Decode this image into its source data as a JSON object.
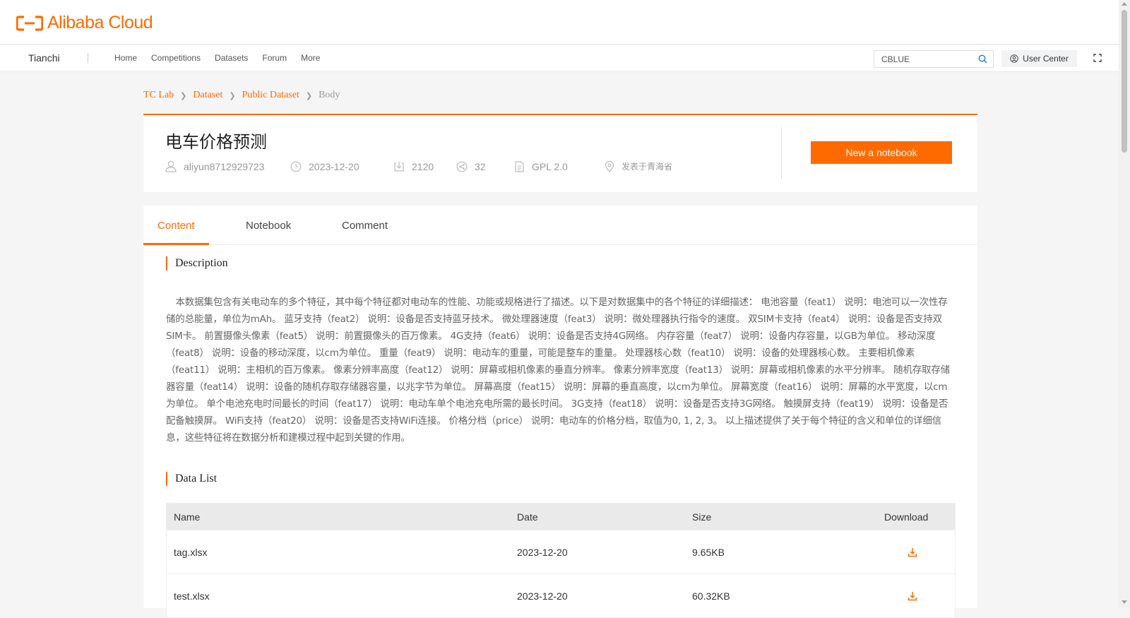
{
  "brand": {
    "logo_text": "Alibaba Cloud",
    "name": "Tianchi"
  },
  "nav": {
    "links": [
      "Home",
      "Competitions",
      "Datasets",
      "Forum",
      "More"
    ]
  },
  "search": {
    "value": "CBLUE"
  },
  "user_center": {
    "label": "User Center"
  },
  "breadcrumb": [
    "TC Lab",
    "Dataset",
    "Public Dataset",
    "Body"
  ],
  "dataset": {
    "title": "电车价格预测",
    "author": "aliyun8712929723",
    "date": "2023-12-20",
    "downloads": "2120",
    "shares": "32",
    "license": "GPL 2.0",
    "location": "发表于青海省"
  },
  "actions": {
    "new_notebook": "New a notebook"
  },
  "tabs": [
    "Content",
    "Notebook",
    "Comment"
  ],
  "sections": {
    "description": "Description",
    "data_list": "Data List"
  },
  "description_text": "本数据集包含有关电动车的多个特征，其中每个特征都对电动车的性能、功能或规格进行了描述。以下是对数据集中的各个特征的详细描述： 电池容量（feat1） 说明：电池可以一次性存储的总能量，单位为mAh。 蓝牙支持（feat2） 说明：设备是否支持蓝牙技术。 微处理器速度（feat3） 说明：微处理器执行指令的速度。 双SIM卡支持（feat4） 说明：设备是否支持双SIM卡。 前置摄像头像素（feat5） 说明：前置摄像头的百万像素。 4G支持（feat6） 说明：设备是否支持4G网络。 内存容量（feat7） 说明：设备内存容量，以GB为单位。 移动深度（feat8） 说明：设备的移动深度，以cm为单位。 重量（feat9） 说明：电动车的重量，可能是整车的重量。 处理器核心数（feat10） 说明：设备的处理器核心数。 主要相机像素（feat11） 说明：主相机的百万像素。 像素分辨率高度（feat12） 说明：屏幕或相机像素的垂直分辨率。 像素分辨率宽度（feat13） 说明：屏幕或相机像素的水平分辨率。 随机存取存储器容量（feat14） 说明：设备的随机存取存储器容量，以兆字节为单位。 屏幕高度（feat15） 说明：屏幕的垂直高度，以cm为单位。 屏幕宽度（feat16） 说明：屏幕的水平宽度，以cm为单位。 单个电池充电时间最长的时间（feat17） 说明：电动车单个电池充电所需的最长时间。 3G支持（feat18） 说明：设备是否支持3G网络。 触摸屏支持（feat19） 说明：设备是否配备触摸屏。 WiFi支持（feat20） 说明：设备是否支持WiFi连接。 价格分档（price） 说明：电动车的价格分档，取值为0, 1, 2, 3。 以上描述提供了关于每个特征的含义和单位的详细信息，这些特征将在数据分析和建模过程中起到关键的作用。",
  "table": {
    "headers": [
      "Name",
      "Date",
      "Size",
      "Download"
    ],
    "rows": [
      {
        "name": "tag.xlsx",
        "date": "2023-12-20",
        "size": "9.65KB"
      },
      {
        "name": "test.xlsx",
        "date": "2023-12-20",
        "size": "60.32KB"
      }
    ]
  },
  "colors": {
    "accent": "#ff6a00"
  }
}
